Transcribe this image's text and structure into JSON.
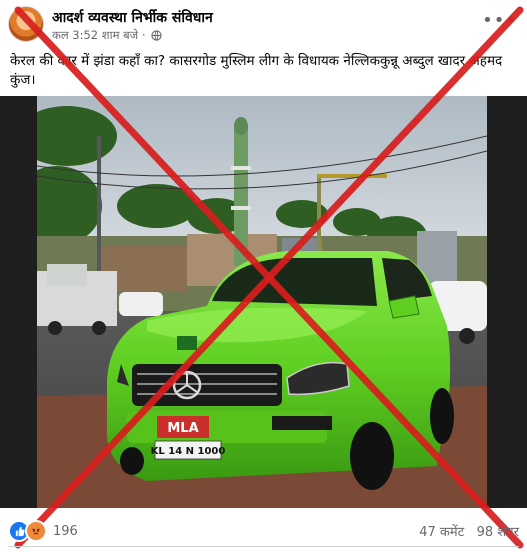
{
  "post": {
    "author": "आदर्श व्यवस्था निर्भीक संविधान",
    "timestamp": "कल 3:52 शाम बजे ·",
    "privacy_icon": "globe-icon",
    "more_icon": "more-options-icon",
    "caption": "केरल की कार में झंडा कहाँ का? कासरगोड मुस्लिम लीग के विधायक नेल्लिककुन्नू अब्दुल खादर अहमद कुंज।"
  },
  "photo": {
    "plate_top": "MLA",
    "plate_number": "KL 14 N 1000",
    "car_color": "#5fcf22",
    "overlay_cross_color": "#d81e1e"
  },
  "footer": {
    "reaction_icons": [
      "like-icon",
      "angry-icon"
    ],
    "reaction_count": "196",
    "comments": "47 कमेंट",
    "shares": "98 शेयर"
  }
}
